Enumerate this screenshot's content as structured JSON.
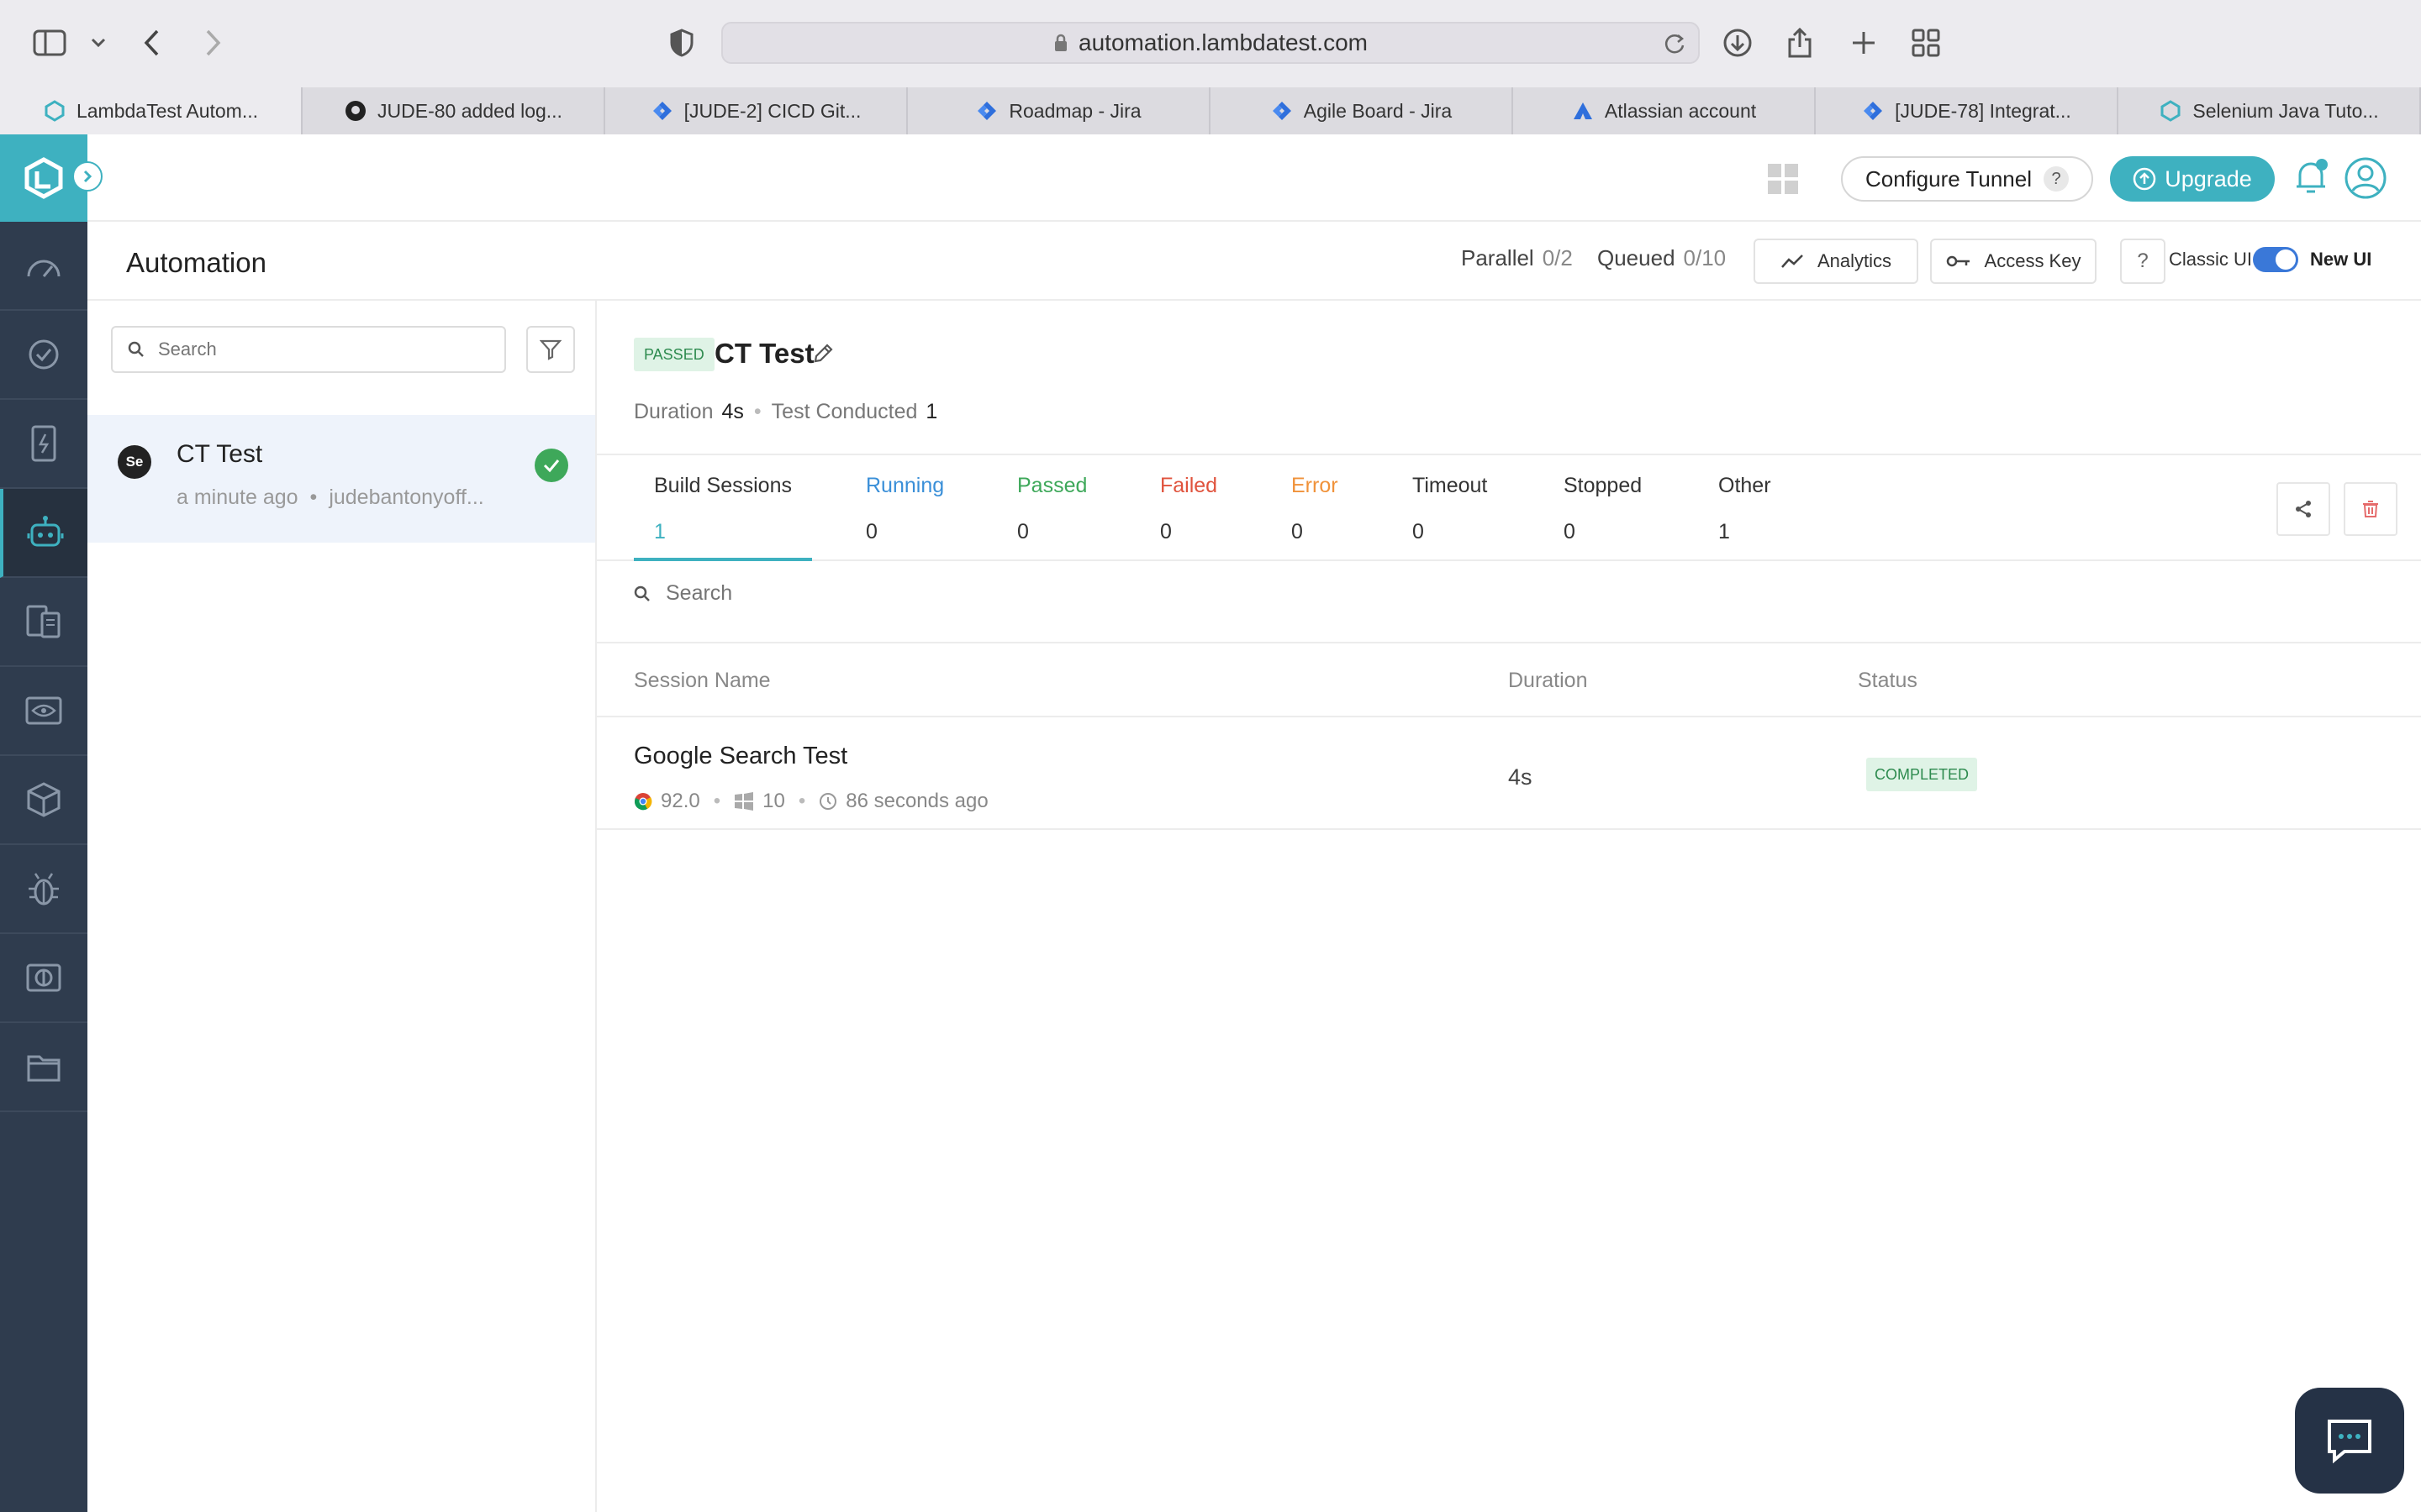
{
  "browser": {
    "url": "automation.lambdatest.com",
    "tabs": [
      {
        "label": "LambdaTest Autom...",
        "icon": "lambdatest-icon",
        "active": true
      },
      {
        "label": "JUDE-80 added log...",
        "icon": "github-icon",
        "active": false
      },
      {
        "label": "[JUDE-2] CICD Git...",
        "icon": "jira-icon",
        "active": false
      },
      {
        "label": "Roadmap - Jira",
        "icon": "jira-icon",
        "active": false
      },
      {
        "label": "Agile Board - Jira",
        "icon": "jira-icon",
        "active": false
      },
      {
        "label": "Atlassian account",
        "icon": "atlassian-icon",
        "active": false
      },
      {
        "label": "[JUDE-78] Integrat...",
        "icon": "jira-icon",
        "active": false
      },
      {
        "label": "Selenium Java Tuto...",
        "icon": "lambdatest-icon",
        "active": false
      }
    ]
  },
  "header": {
    "configure_tunnel": "Configure Tunnel",
    "help_q": "?",
    "upgrade": "Upgrade"
  },
  "subheader": {
    "title": "Automation",
    "parallel_label": "Parallel",
    "parallel_value": "0/2",
    "queued_label": "Queued",
    "queued_value": "0/10",
    "analytics": "Analytics",
    "access_key": "Access Key",
    "help": "?",
    "classic_ui": "Classic UI",
    "new_ui": "New UI"
  },
  "build_list": {
    "search_placeholder": "Search",
    "items": [
      {
        "badge": "Se",
        "name": "CT Test",
        "time": "a minute ago",
        "user": "judebantonyoff...",
        "status": "passed"
      }
    ]
  },
  "build_detail": {
    "status_badge": "PASSED",
    "title": "CT Test",
    "duration_label": "Duration",
    "duration_value": "4s",
    "conducted_label": "Test Conducted",
    "conducted_value": "1",
    "tabs": [
      {
        "label": "Build Sessions",
        "count": "1",
        "color": "#333333"
      },
      {
        "label": "Running",
        "count": "0",
        "color": "#3a8fd8"
      },
      {
        "label": "Passed",
        "count": "0",
        "color": "#3ea85a"
      },
      {
        "label": "Failed",
        "count": "0",
        "color": "#e0533d"
      },
      {
        "label": "Error",
        "count": "0",
        "color": "#f0923a"
      },
      {
        "label": "Timeout",
        "count": "0",
        "color": "#333333"
      },
      {
        "label": "Stopped",
        "count": "0",
        "color": "#333333"
      },
      {
        "label": "Other",
        "count": "1",
        "color": "#333333"
      }
    ],
    "session_search_placeholder": "Search",
    "columns": {
      "name": "Session Name",
      "duration": "Duration",
      "status": "Status"
    },
    "sessions": [
      {
        "name": "Google Search Test",
        "browser_version": "92.0",
        "os_version": "10",
        "time": "86 seconds ago",
        "duration": "4s",
        "status": "COMPLETED"
      }
    ]
  },
  "colors": {
    "accent": "#3eb1c0",
    "rail": "#2f3c4e",
    "passed": "#3ea85a"
  }
}
